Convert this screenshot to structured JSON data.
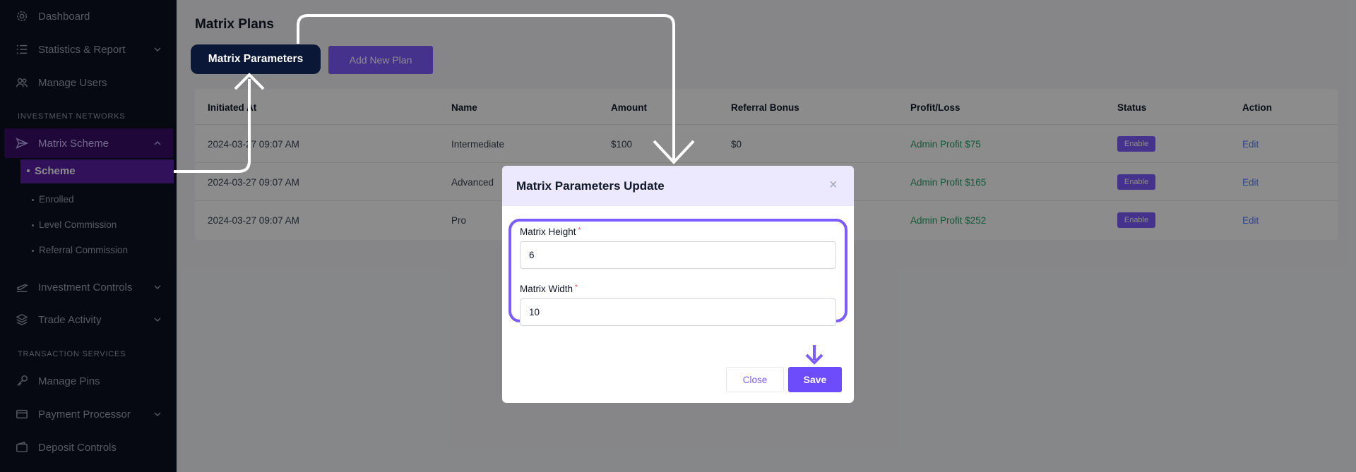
{
  "sidebar": {
    "items": [
      {
        "label": "Dashboard",
        "icon": "gear-icon"
      },
      {
        "label": "Statistics & Report",
        "icon": "list-icon"
      },
      {
        "label": "Manage Users",
        "icon": "users-icon"
      },
      {
        "label": "Matrix Scheme",
        "icon": "send-icon"
      },
      {
        "label": "Investment Controls",
        "icon": "plane-icon"
      },
      {
        "label": "Trade Activity",
        "icon": "layers-icon"
      },
      {
        "label": "Manage Pins",
        "icon": "key-icon"
      },
      {
        "label": "Payment Processor",
        "icon": "card-icon"
      },
      {
        "label": "Deposit Controls",
        "icon": "wallet-icon"
      }
    ],
    "sections": [
      "INVESTMENT NETWORKS",
      "TRANSACTION SERVICES"
    ],
    "sub_items": [
      "Scheme",
      "Enrolled",
      "Level Commission",
      "Referral Commission"
    ]
  },
  "header": {
    "title": "Matrix Plans",
    "matrix_button": "Matrix Parameters",
    "add_button": "Add New Plan"
  },
  "table": {
    "columns": [
      "Initiated At",
      "Name",
      "Amount",
      "Referral Bonus",
      "Profit/Loss",
      "Status",
      "Action"
    ],
    "rows": [
      {
        "initiated": "2024-03-27 09:07 AM",
        "name": "Intermediate",
        "amount": "$100",
        "referral": "$0",
        "profit": "Admin Profit $75",
        "status": "Enable",
        "action": "Edit"
      },
      {
        "initiated": "2024-03-27 09:07 AM",
        "name": "Advanced",
        "amount": "",
        "referral": "",
        "profit": "Admin Profit $165",
        "status": "Enable",
        "action": "Edit"
      },
      {
        "initiated": "2024-03-27 09:07 AM",
        "name": "Pro",
        "amount": "",
        "referral": "",
        "profit": "Admin Profit $252",
        "status": "Enable",
        "action": "Edit"
      }
    ]
  },
  "modal": {
    "title": "Matrix Parameters Update",
    "close_glyph": "×",
    "height_label": "Matrix Height",
    "height_value": "6",
    "width_label": "Matrix Width",
    "width_value": "10",
    "required_mark": "*",
    "close_button": "Close",
    "save_button": "Save"
  },
  "colors": {
    "sidebar_bg": "#0b1220",
    "accent": "#7c5cff",
    "active_item": "#5b1fa7",
    "profit_text": "#22a06b",
    "link": "#5b7cff"
  }
}
